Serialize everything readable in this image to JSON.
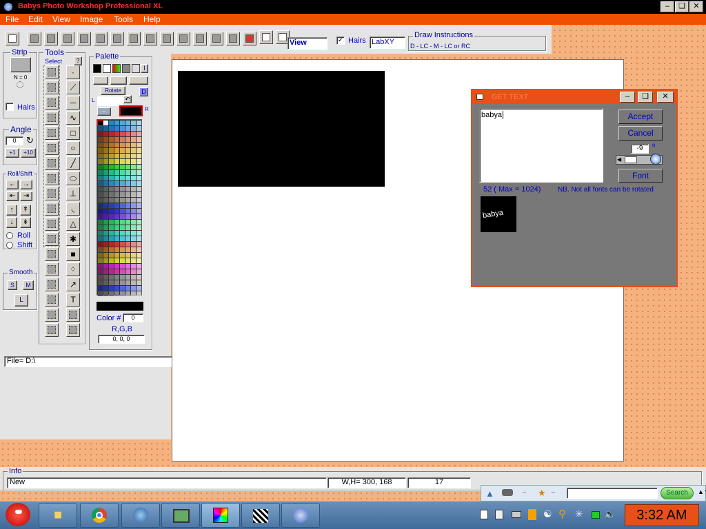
{
  "window": {
    "title": "Babys Photo Workshop Professional XL"
  },
  "menu": [
    "File",
    "Edit",
    "View",
    "Image",
    "Tools",
    "Help"
  ],
  "toolbar": {
    "view_field": "View",
    "hairs_checked": true,
    "hairs_label": "Hairs",
    "lab_field": "LabXY",
    "draw_instructions_title": "Draw Instructions",
    "draw_instructions_text": "D - LC - M - LC or RC"
  },
  "strip": {
    "title": "Strip",
    "n_label": "N = 0",
    "hairs_label": "Hairs",
    "hairs_checked": false
  },
  "tools": {
    "title": "Tools",
    "select_label": "Select",
    "help_glyph": "?",
    "text_glyph": "T"
  },
  "angle": {
    "title": "Angle",
    "value": "0",
    "btn_plus1": "+1",
    "btn_plus10": "+10"
  },
  "rollshift": {
    "title": "Roll/Shift",
    "roll_label": "Roll",
    "shift_label": "Shift",
    "selected": "Roll"
  },
  "smooth": {
    "title": "Smooth",
    "btn_s": "S",
    "btn_m": "M",
    "btn_l": "L"
  },
  "palette": {
    "title": "Palette",
    "rotate_label": "Rotate",
    "d_label": "D",
    "i_label": "I",
    "l_label": "L",
    "r_label": "R",
    "color_label": "Color #",
    "color_value": "0",
    "rgb_label": "R,G,B",
    "rgb_value": "0, 0, 0",
    "primary_color": "#000000"
  },
  "file_field": "File= D:\\",
  "image": {
    "width": 300,
    "height": 168,
    "color": "#000000"
  },
  "dialog": {
    "title": "GET TEXT",
    "text_value": "babya",
    "accept_label": "Accept",
    "cancel_label": "Cancel",
    "angle_value": "-9",
    "degree_symbol": "o",
    "font_label": "Font",
    "count_label": "52  ( Max = 1024)",
    "note": "NB.  Not all fonts can be rotated",
    "preview_text": "babya"
  },
  "info": {
    "title": "Info",
    "status": "New",
    "size": "W,H= 300, 168",
    "value": "17"
  },
  "search": {
    "button_label": "Search",
    "input_value": ""
  },
  "taskbar": {
    "clock": "3:32 AM"
  }
}
